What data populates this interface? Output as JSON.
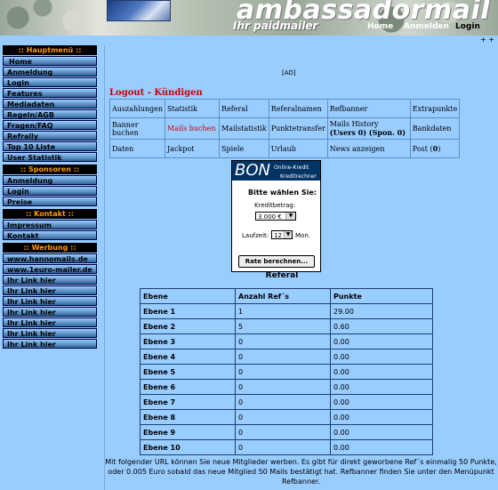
{
  "header": {
    "brand": "ambassadormail",
    "tagline": "Ihr paidmailer",
    "nav": [
      "Home",
      "Anmelden",
      "Login"
    ],
    "plus": "+ +"
  },
  "sidebar": {
    "main_title": ":: Hauptmenü ::",
    "main_items": [
      "Home",
      "Anmeldung",
      "Login",
      "Features",
      "Mediadaten",
      "Regeln/AGB",
      "Fragen/FAQ",
      "Refrally",
      "Top 10 Liste",
      "User Statistik"
    ],
    "sponsor_title": ":: Sponsoren ::",
    "sponsor_items": [
      "Anmeldung",
      "Login",
      "Preise"
    ],
    "kontakt_title": ":: Kontakt ::",
    "kontakt_items": [
      "Impressum",
      "Kontakt"
    ],
    "werbung_title": ":: Werbung ::",
    "werbung_items": [
      "www.hannomails.de",
      "www.1euro-mailer.de",
      "Ihr Link hier",
      "Ihr Link hier",
      "Ihr Link hier",
      "Ihr Link hier",
      "Ihr Link hier",
      "Ihr Link hier",
      "Ihr Link hier"
    ]
  },
  "main": {
    "ad": "[AD]",
    "logout": "Logout - Kündigen",
    "menu_rows": [
      [
        "Auszahlungen",
        "Statistik",
        "Referal",
        "Referalnamen",
        "Refbanner",
        "Extrapunkte"
      ],
      [
        "Banner buchen",
        "Mails buchen",
        "Mailstatistik",
        "Punktetransfer",
        "Mails History (Users 0) (Spon. 0)",
        "Bankdaten"
      ],
      [
        "Daten",
        "Jackpot",
        "Spiele",
        "Urlaub",
        "News anzeigen",
        "Post (0)"
      ]
    ],
    "widget": {
      "logo": "BON",
      "sub1": "Online-Kredit",
      "sub2": "Kreditrechner",
      "title": "Bitte wählen Sie:",
      "amount_label": "Kreditbetrag:",
      "amount_value": "3.000 €",
      "term_label": "Laufzeit:",
      "term_value": "12",
      "term_unit": "Mon.",
      "button": "Rate berechnen..."
    },
    "referal_title": "Referal",
    "ref_headers": [
      "Ebene",
      "Anzahl Ref´s",
      "Punkte"
    ],
    "ref_rows": [
      [
        "Ebene 1",
        "1",
        "29.00"
      ],
      [
        "Ebene 2",
        "5",
        "0.60"
      ],
      [
        "Ebene 3",
        "0",
        "0.00"
      ],
      [
        "Ebene 4",
        "0",
        "0.00"
      ],
      [
        "Ebene 5",
        "0",
        "0.00"
      ],
      [
        "Ebene 6",
        "0",
        "0.00"
      ],
      [
        "Ebene 7",
        "0",
        "0.00"
      ],
      [
        "Ebene 8",
        "0",
        "0.00"
      ],
      [
        "Ebene 9",
        "0",
        "0.00"
      ],
      [
        "Ebene 10",
        "0",
        "0.00"
      ]
    ],
    "footer": "Mit folgender URL können Sie neue Mitglieder werben. Es gibt für direkt geworbene Ref´s einmalig 50 Punkte, oder 0.005 Euro sobald das neue Mitglied 50 Mails bestätigt hat. Refbanner finden Sie unter den Menüpunkt Refbanner."
  }
}
